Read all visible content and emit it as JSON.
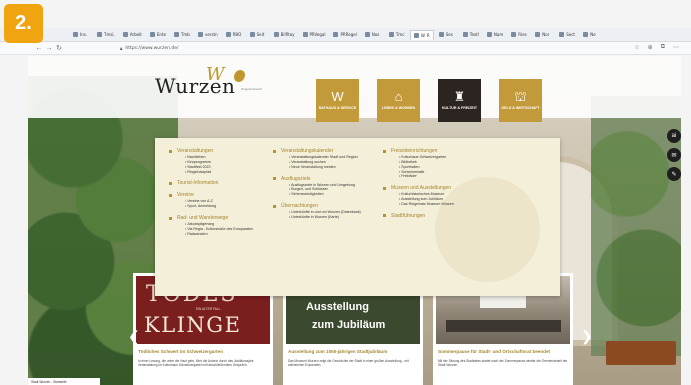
{
  "badge": {
    "label": "2."
  },
  "browser": {
    "tabs": [
      {
        "label": "Ins."
      },
      {
        "label": "Tmsi."
      },
      {
        "label": "Arbeit"
      },
      {
        "label": "Ente"
      },
      {
        "label": "Tmb"
      },
      {
        "label": "verstn"
      },
      {
        "label": "RBO"
      },
      {
        "label": "Seit"
      },
      {
        "label": "Bilfltoy"
      },
      {
        "label": "PRVegal"
      },
      {
        "label": "PRRegel"
      },
      {
        "label": "Nos"
      },
      {
        "label": "Tmc"
      },
      {
        "label": "W. R",
        "active": true
      },
      {
        "label": "Ses"
      },
      {
        "label": "Textl"
      },
      {
        "label": "Nam"
      },
      {
        "label": "Ries"
      },
      {
        "label": "Nor"
      },
      {
        "label": "Sect"
      },
      {
        "label": "Ne"
      }
    ],
    "nav": {
      "back": "←",
      "forward": "→",
      "reload": "↻"
    },
    "url": "https://www.wurzen.de/",
    "tools": [
      "☆",
      "⊕",
      "⧉",
      "⋯"
    ]
  },
  "header": {
    "logo_text": "Wurzen",
    "logo_mark": "W",
    "logo_sub": "Ringelnatzstadt"
  },
  "nav_tiles": [
    {
      "icon": "W",
      "label": "RATHAUS & SERVICE"
    },
    {
      "icon": "⌂",
      "label": "LEBEN & WOHNEN"
    },
    {
      "icon": "♜",
      "label": "KULTUR & FREIZEIT",
      "active": true
    },
    {
      "icon": "⛫",
      "label": "GELD & WIRTSCHAFT"
    }
  ],
  "social": [
    "ai",
    "✉",
    "✎"
  ],
  "mega_menu": {
    "col1": [
      {
        "head": "Veranstaltungen",
        "items": [
          "Nachtleben",
          "Kinoprogramm",
          "Stadtfest 2023",
          "Ringelnatzpfad"
        ]
      },
      {
        "head": "Tourist-Information",
        "items": []
      },
      {
        "head": "Vereine",
        "items": [
          "Vereine von A-Z",
          "Sport- Anmeldung"
        ]
      },
      {
        "head": "Rad- und Wanderwege",
        "items": [
          "Jakobspilgerweg",
          "Via Regia - Kulturstraße des Europarates",
          "Radwandern"
        ]
      }
    ],
    "col2": [
      {
        "head": "Veranstaltungskalender",
        "items": [
          "Veranstaltungskalender Stadt und Region",
          "Veranstaltung suchen",
          "Neue Veranstaltung melden"
        ]
      },
      {
        "head": "Ausflugsziele",
        "items": [
          "Ausflugsziele in Wurzen und Umgebung",
          "Burgen- und Schlösser",
          "Sehenswürdigkeiten"
        ]
      },
      {
        "head": "Übernachtungen",
        "items": [
          "Unterkünfte in und um Wurzen (Datenbank)",
          "Unterkünfte in Wurzen (Karte)"
        ]
      }
    ],
    "col3": [
      {
        "head": "Freizeiteinrichtungen",
        "items": [
          "Kulturhaus Schweizergarten",
          "Bibliothek",
          "Sporthallen",
          "Schwimmhalle",
          "Freibäder"
        ]
      },
      {
        "head": "Museen und Ausstellungen",
        "items": [
          "Kulturhistorisches Museum",
          "Ausstellung zum Jubiläum",
          "Das Ringelnatz Museum Wurzen"
        ]
      },
      {
        "head": "Stadtführungen",
        "items": []
      }
    ]
  },
  "cards": [
    {
      "image_text_top": "TODES",
      "image_text_bottom": "KLINGE",
      "image_caption": "EIN ALTER FALL",
      "title": "Tödliches Schwert im Schweizergarten",
      "text": "In einer Lesung, die unter die Haut geht, führt die Autorin durch das Jubiläumsjahr. Veranstaltung im Kulturhaus Schweizergarten mit anschließendem Gespräch."
    },
    {
      "image_text_top": "Ausstellung",
      "image_text_bottom": "zum Jubiläum",
      "title": "Ausstellung zum 1050-jährigen Stadtjubiläum",
      "text": "Das Museum Wurzen zeigt die Geschichte der Stadt in einer großen Ausstellung - mit zahlreichen Exponaten."
    },
    {
      "title": "Sommerpause für Stadt- und Ortschaftsrat beendet",
      "text": "Mit der Sitzung des Stadtrates startet nach der Sommerpause wieder die Gremienarbeit der Stadt Wurzen."
    }
  ],
  "arrows": {
    "left": "❮",
    "right": "❯"
  },
  "footer_label": "Stadt Wurzen - Startseite"
}
